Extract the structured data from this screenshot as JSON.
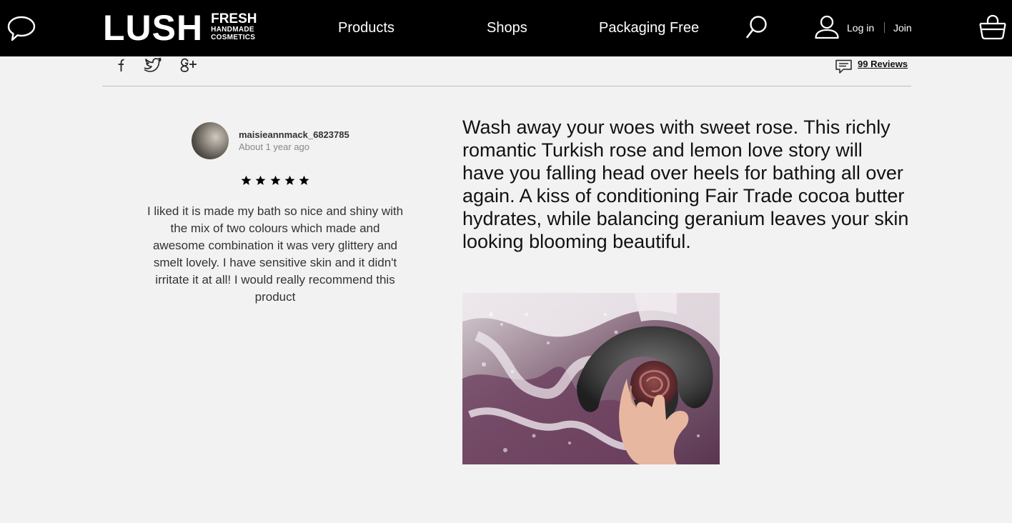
{
  "header": {
    "logo_word": "LUSH",
    "logo_fresh": "FRESH",
    "logo_handmade": "HANDMADE",
    "logo_cosmetics": "COSMETICS",
    "nav": [
      "Products",
      "Shops",
      "Packaging Free"
    ],
    "login_label": "Log in",
    "join_label": "Join",
    "icons": [
      "chat-icon",
      "search-icon",
      "user-icon",
      "basket-icon"
    ]
  },
  "share": {
    "icons": [
      "facebook-icon",
      "twitter-icon",
      "google-plus-icon"
    ]
  },
  "reviews": {
    "link_label": "99 Reviews"
  },
  "review": {
    "username": "maisieannmack_6823785",
    "time": "About 1 year ago",
    "rating": 5,
    "text": "I liked it is made my bath so nice and shiny with the mix of two colours which made and awesome combination it was very glittery and smelt lovely. I have sensitive skin and it didn't irritate it at all! I would really recommend this product"
  },
  "product": {
    "description": "Wash away your woes with sweet rose. This richly romantic Turkish rose and lemon love story will have you falling head over heels for bathing all over again. A kiss of conditioning Fair Trade cocoa butter hydrates, while balancing geranium leaves your skin looking blooming beautiful."
  },
  "colors": {
    "header_bg": "#000000",
    "page_bg": "#f2f2f2",
    "text": "#111111",
    "muted": "#888888"
  }
}
